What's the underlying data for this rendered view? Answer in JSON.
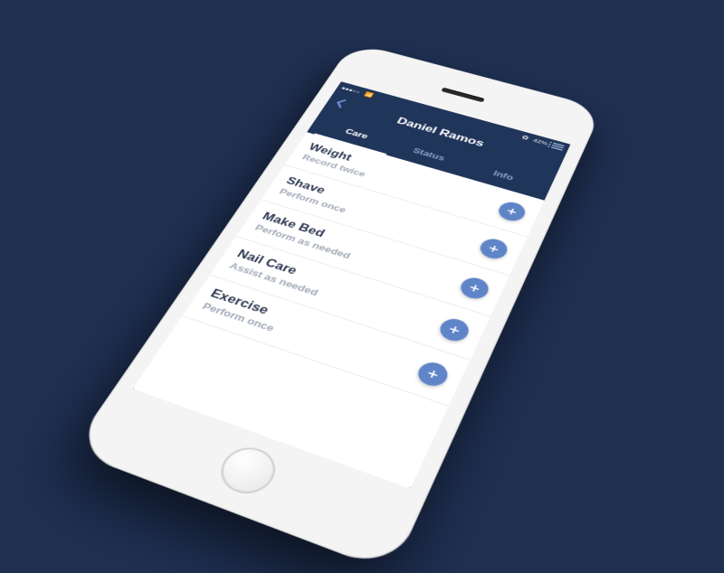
{
  "status": {
    "carrier_signal": 3,
    "percent": "42%"
  },
  "header": {
    "title": "Daniel Ramos",
    "tabs": [
      {
        "label": "Care",
        "active": true
      },
      {
        "label": "Status",
        "active": false
      },
      {
        "label": "Info",
        "active": false
      }
    ]
  },
  "care_items": [
    {
      "title": "Weight",
      "subtitle": "Record twice"
    },
    {
      "title": "Shave",
      "subtitle": "Perform once"
    },
    {
      "title": "Make Bed",
      "subtitle": "Perform as needed"
    },
    {
      "title": "Nail Care",
      "subtitle": "Assist as needed"
    },
    {
      "title": "Exercise",
      "subtitle": "Perform once"
    }
  ]
}
